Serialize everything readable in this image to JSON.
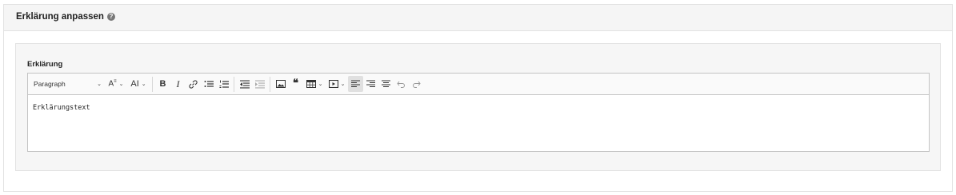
{
  "panel": {
    "title": "Erklärung anpassen",
    "help_icon": "question-circle-icon"
  },
  "field": {
    "label": "Erklärung",
    "content": "Erklärungstext"
  },
  "toolbar": {
    "heading_select": "Paragraph",
    "heading_chevron": "⌄",
    "font_size_chevron": "⌄",
    "font_family_chevron": "⌄",
    "font_size_glyph": "A",
    "font_family_glyph": "AI",
    "bold": "B",
    "italic": "I",
    "table_chevron": "⌄",
    "media_chevron": "⌄",
    "icons": [
      "font-size-icon",
      "font-family-icon",
      "bold-icon",
      "italic-icon",
      "link-icon",
      "bulleted-list-icon",
      "numbered-list-icon",
      "outdent-icon",
      "indent-icon",
      "image-icon",
      "blockquote-icon",
      "table-icon",
      "media-icon",
      "align-left-icon",
      "align-right-icon",
      "align-center-icon",
      "undo-icon",
      "redo-icon"
    ]
  },
  "colors": {
    "header_bg": "#f5f5f5",
    "box_bg": "#f6f6f6",
    "border": "#e2e2e2",
    "active_btn": "#e0e0e0"
  }
}
